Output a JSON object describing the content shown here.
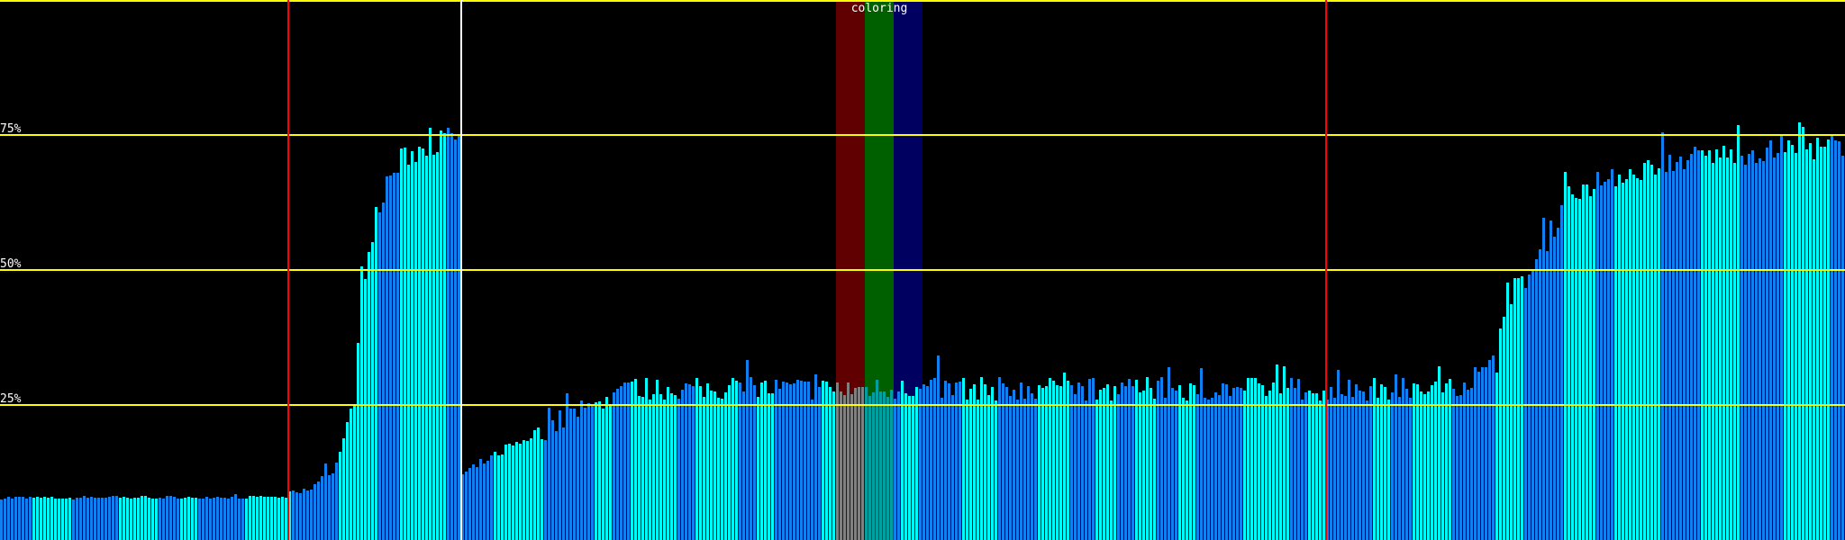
{
  "chart_data": {
    "type": "bar",
    "title": "",
    "xlabel": "",
    "ylabel": "",
    "ylim": [
      0,
      100
    ],
    "bar_count": 512,
    "profile": [
      [
        0,
        7.8
      ],
      [
        80,
        8.0
      ],
      [
        86,
        9.5
      ],
      [
        92,
        13
      ],
      [
        96,
        20
      ],
      [
        98,
        27
      ],
      [
        100,
        45
      ],
      [
        102,
        55
      ],
      [
        105,
        62
      ],
      [
        110,
        70
      ],
      [
        118,
        73
      ],
      [
        127,
        75
      ],
      [
        128,
        12
      ],
      [
        140,
        17
      ],
      [
        155,
        22
      ],
      [
        165,
        25
      ],
      [
        175,
        28
      ],
      [
        400,
        28
      ],
      [
        410,
        30
      ],
      [
        415,
        33
      ],
      [
        418,
        45
      ],
      [
        425,
        50
      ],
      [
        435,
        64
      ],
      [
        445,
        67
      ],
      [
        470,
        71
      ],
      [
        511,
        73
      ]
    ],
    "yticks": [
      {
        "value": 25,
        "label": "25%"
      },
      {
        "value": 50,
        "label": "50%"
      },
      {
        "value": 75,
        "label": "75%"
      },
      {
        "value": 100,
        "label": ""
      }
    ],
    "markers": [
      {
        "bar": 80,
        "color": "#ff0000"
      },
      {
        "bar": 128,
        "color": "#ffffff"
      },
      {
        "bar": 368,
        "color": "#ff0000"
      }
    ],
    "highlight": {
      "label": "coloring",
      "bands": [
        {
          "from_bar": 232,
          "to_bar": 240,
          "color": "#600000",
          "bar_tint": "#808080"
        },
        {
          "from_bar": 240,
          "to_bar": 248,
          "color": "#006000",
          "bar_tint": "#00a0a0"
        },
        {
          "from_bar": 248,
          "to_bar": 256,
          "color": "#000060",
          "bar_tint": null
        }
      ]
    },
    "series_colors": [
      "#1080f0",
      "#00ffff"
    ]
  }
}
